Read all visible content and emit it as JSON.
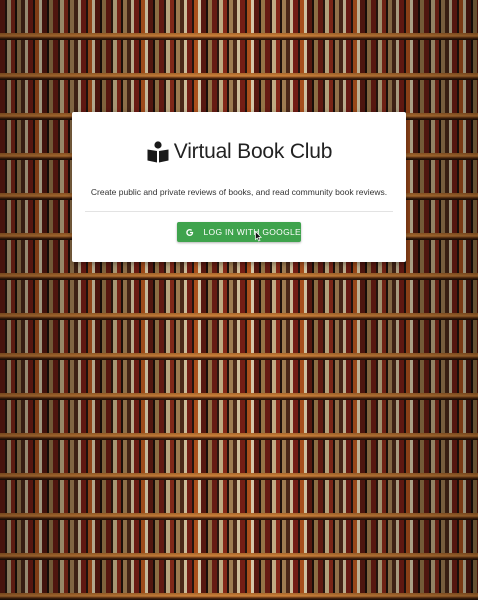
{
  "app": {
    "title": "Virtual Book Club",
    "tagline": "Create public and private reviews of books, and read community book reviews."
  },
  "login": {
    "button_label": "LOG IN WITH GOOGLE",
    "button_color": "#3fa34d"
  },
  "icons": {
    "logo": "book-reader-icon",
    "provider": "google-g-icon",
    "pointer": "mouse-cursor-icon"
  },
  "colors": {
    "card_background": "#ffffff",
    "title_text": "#222222",
    "background_theme": "library-bookshelves"
  }
}
